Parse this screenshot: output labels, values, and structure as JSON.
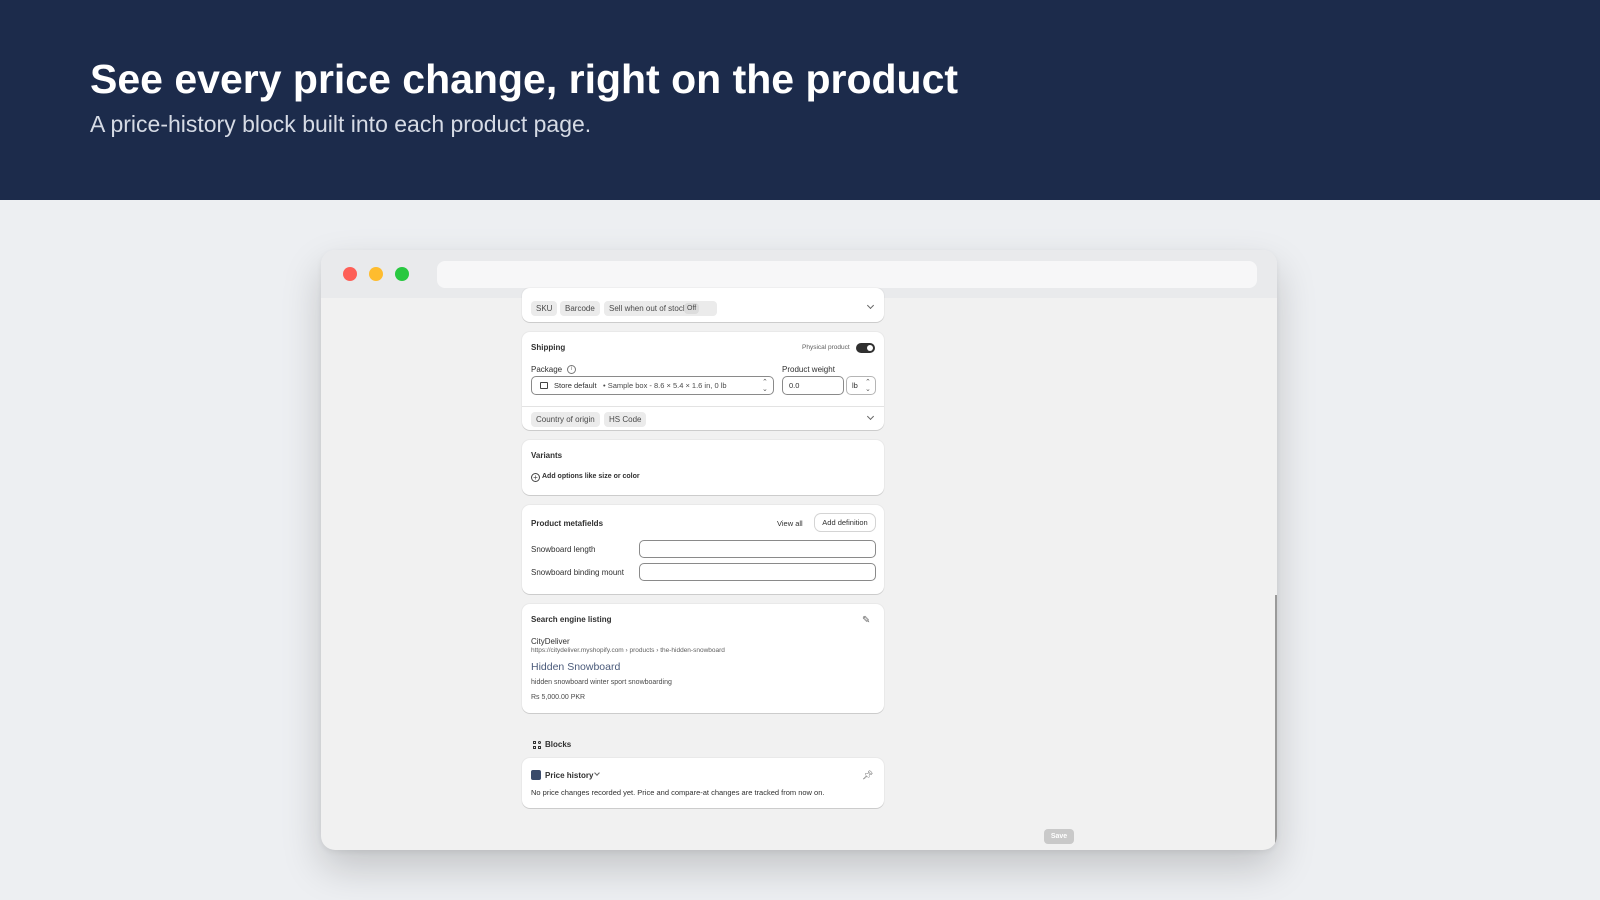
{
  "hero": {
    "title": "See every price change, right on the product",
    "subtitle": "A price-history block built into each product page."
  },
  "inventory_card": {
    "chips": [
      "SKU",
      "Barcode",
      "Sell when out of stock"
    ],
    "off_badge": "Off"
  },
  "shipping": {
    "title": "Shipping",
    "physical_label": "Physical product",
    "package_label": "Package",
    "package_value": "Store default",
    "package_detail": "• Sample box - 8.6 × 5.4 × 1.6 in, 0 lb",
    "weight_label": "Product weight",
    "weight_value": "0.0",
    "weight_unit": "lb",
    "chips": [
      "Country of origin",
      "HS Code"
    ]
  },
  "variants": {
    "title": "Variants",
    "add_label": "Add options like size or color"
  },
  "metafields": {
    "title": "Product metafields",
    "view_all": "View all",
    "add_definition": "Add definition",
    "fields": [
      "Snowboard length",
      "Snowboard binding mount"
    ]
  },
  "seo": {
    "title": "Search engine listing",
    "store": "CityDeliver",
    "url": "https://citydeliver.myshopify.com › products › the-hidden-snowboard",
    "page_title": "Hidden Snowboard",
    "description": "hidden snowboard winter sport snowboarding",
    "price": "Rs 5,000.00 PKR"
  },
  "blocks": {
    "section_label": "Blocks",
    "block_title": "Price history",
    "message": "No price changes recorded yet. Price and compare-at changes are tracked from now on."
  },
  "actions": {
    "save": "Save"
  },
  "colors": {
    "hero_bg": "#1c2b4b",
    "page_bg": "#edeff2",
    "window_bg": "#f1f1f1",
    "traffic_red": "#fe5f57",
    "traffic_yellow": "#febc2e",
    "traffic_green": "#28c840"
  }
}
